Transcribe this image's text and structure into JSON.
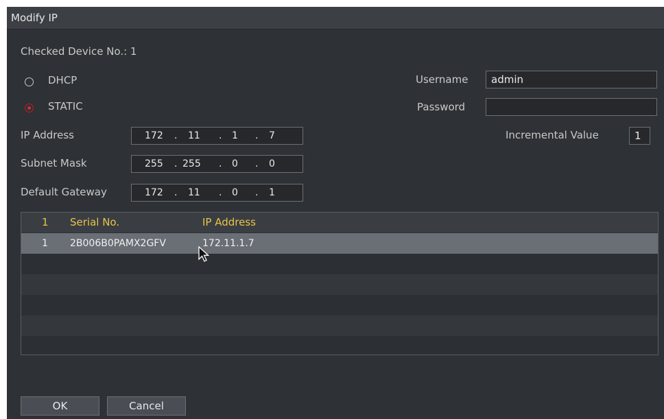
{
  "dialog": {
    "title": "Modify IP"
  },
  "checked_device": "Checked Device No.: 1",
  "mode": {
    "options": [
      {
        "label": "DHCP",
        "selected": false
      },
      {
        "label": "STATIC",
        "selected": true
      }
    ],
    "accent_color": "#d82a2a"
  },
  "form": {
    "ip_label": "IP Address",
    "ip": [
      "172",
      "11",
      "1",
      "7"
    ],
    "subnet_label": "Subnet Mask",
    "subnet": [
      "255",
      "255",
      "0",
      "0"
    ],
    "gateway_label": "Default Gateway",
    "gateway": [
      "172",
      "11",
      "0",
      "1"
    ],
    "username_label": "Username",
    "username_value": "admin",
    "password_label": "Password",
    "password_value": "",
    "incremental_label": "Incremental Value",
    "incremental_value": "1"
  },
  "table": {
    "header_color": "#e8c449",
    "columns": [
      "1",
      "Serial No.",
      "IP Address"
    ],
    "rows": [
      {
        "index": "1",
        "serial": "2B006B0PAMX2GFV",
        "ip": "172.11.1.7"
      }
    ]
  },
  "buttons": {
    "ok": "OK",
    "cancel": "Cancel"
  }
}
